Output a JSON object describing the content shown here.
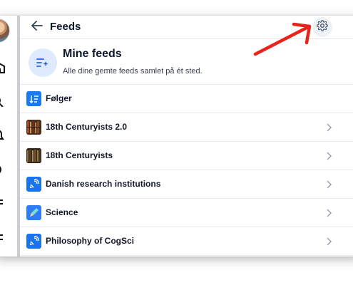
{
  "header": {
    "title": "Feeds"
  },
  "hero": {
    "title": "Mine feeds",
    "description": "Alle dine gemte feeds samlet på ét sted."
  },
  "feeds": [
    {
      "label": "Følger",
      "icon": "following-sort-icon",
      "chevron": false
    },
    {
      "label": "18th Centuryists 2.0",
      "icon": "books-thumbnail",
      "chevron": true
    },
    {
      "label": "18th Centuryists",
      "icon": "books-thumbnail",
      "chevron": true
    },
    {
      "label": "Danish research institutions",
      "icon": "satellite-dish-icon",
      "chevron": true
    },
    {
      "label": "Science",
      "icon": "pencil-science-icon",
      "chevron": true
    },
    {
      "label": "Philosophy of CogSci",
      "icon": "satellite-dish-icon",
      "chevron": true
    }
  ],
  "colors": {
    "accent": "#1a7af0",
    "annotation_arrow": "#e8231b",
    "divider": "#e5e7eb"
  }
}
